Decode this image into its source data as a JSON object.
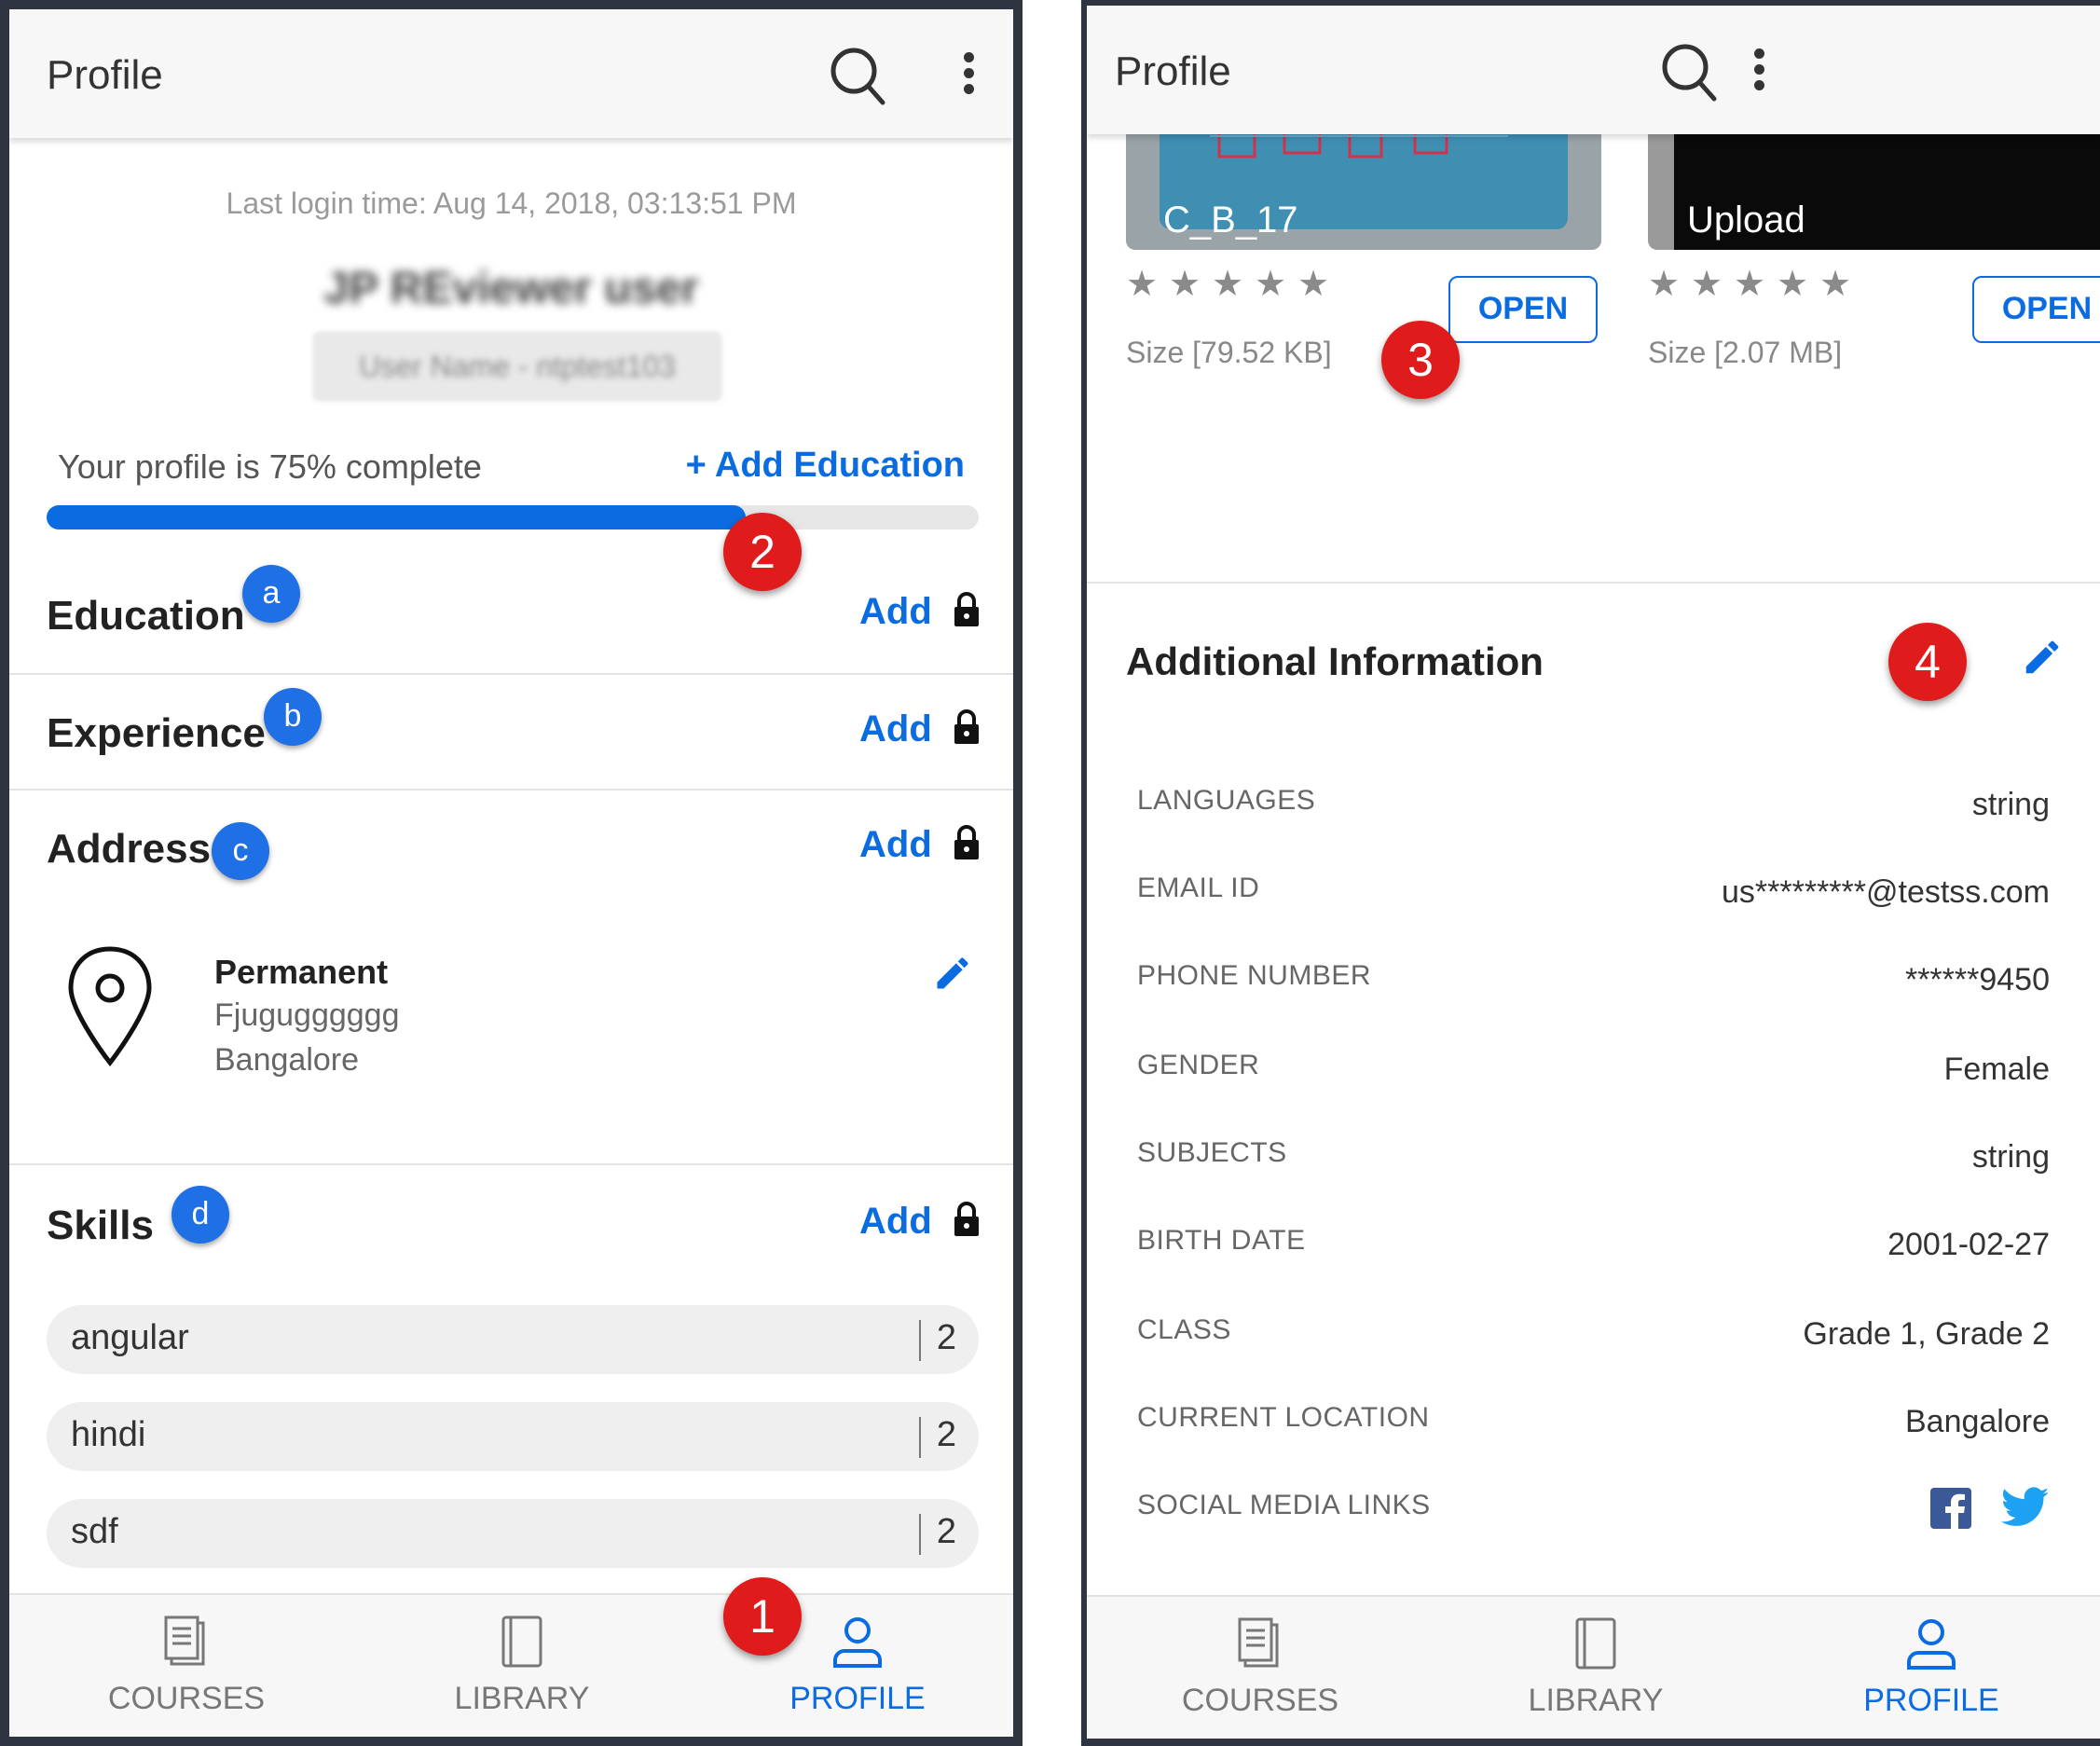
{
  "left": {
    "appbar": {
      "title": "Profile"
    },
    "last_login": "Last login time: Aug 14, 2018, 03:13:51 PM",
    "user": {
      "name": "JP REviewer user",
      "username": "User Name - ntptest103"
    },
    "completion": {
      "text": "Your profile is 75% complete",
      "percent": 75,
      "add_link": "+ Add Education"
    },
    "sections": {
      "education": {
        "title": "Education",
        "add": "Add",
        "badge": "a"
      },
      "experience": {
        "title": "Experience",
        "add": "Add",
        "badge": "b"
      },
      "address": {
        "title": "Address",
        "add": "Add",
        "badge": "c"
      },
      "skills": {
        "title": "Skills",
        "add": "Add",
        "badge": "d"
      }
    },
    "address_entry": {
      "type": "Permanent",
      "line1": "Fjugugggggg",
      "city": "Bangalore"
    },
    "skills": [
      {
        "name": "angular",
        "count": "2"
      },
      {
        "name": "hindi",
        "count": "2"
      },
      {
        "name": "sdf",
        "count": "2"
      }
    ],
    "callouts": {
      "one": "1",
      "two": "2"
    },
    "nav": {
      "courses": "COURSES",
      "library": "LIBRARY",
      "profile": "PROFILE"
    }
  },
  "right": {
    "appbar": {
      "title": "Profile"
    },
    "cards": [
      {
        "title": "C_B_17",
        "size": "Size [79.52 KB]",
        "open": "OPEN",
        "rating": 0
      },
      {
        "title": "Upload",
        "size": "Size [2.07 MB]",
        "open": "OPEN",
        "rating": 0
      }
    ],
    "callouts": {
      "three": "3",
      "four": "4"
    },
    "additional": {
      "title": "Additional Information",
      "rows": [
        {
          "key": "LANGUAGES",
          "value": "string"
        },
        {
          "key": "EMAIL ID",
          "value": "us*********@testss.com"
        },
        {
          "key": "PHONE NUMBER",
          "value": "******9450"
        },
        {
          "key": "GENDER",
          "value": "Female"
        },
        {
          "key": "SUBJECTS",
          "value": "string"
        },
        {
          "key": "BIRTH DATE",
          "value": "2001-02-27"
        },
        {
          "key": "CLASS",
          "value": "Grade 1, Grade 2"
        },
        {
          "key": "CURRENT LOCATION",
          "value": "Bangalore"
        },
        {
          "key": "SOCIAL MEDIA LINKS",
          "value": ""
        }
      ]
    },
    "nav": {
      "courses": "COURSES",
      "library": "LIBRARY",
      "profile": "PROFILE"
    }
  },
  "colors": {
    "accent": "#0b6be0",
    "callout_red": "#e01b1b",
    "badge_blue": "#1f6fe5",
    "facebook": "#3b5998",
    "twitter": "#1da1f2"
  }
}
